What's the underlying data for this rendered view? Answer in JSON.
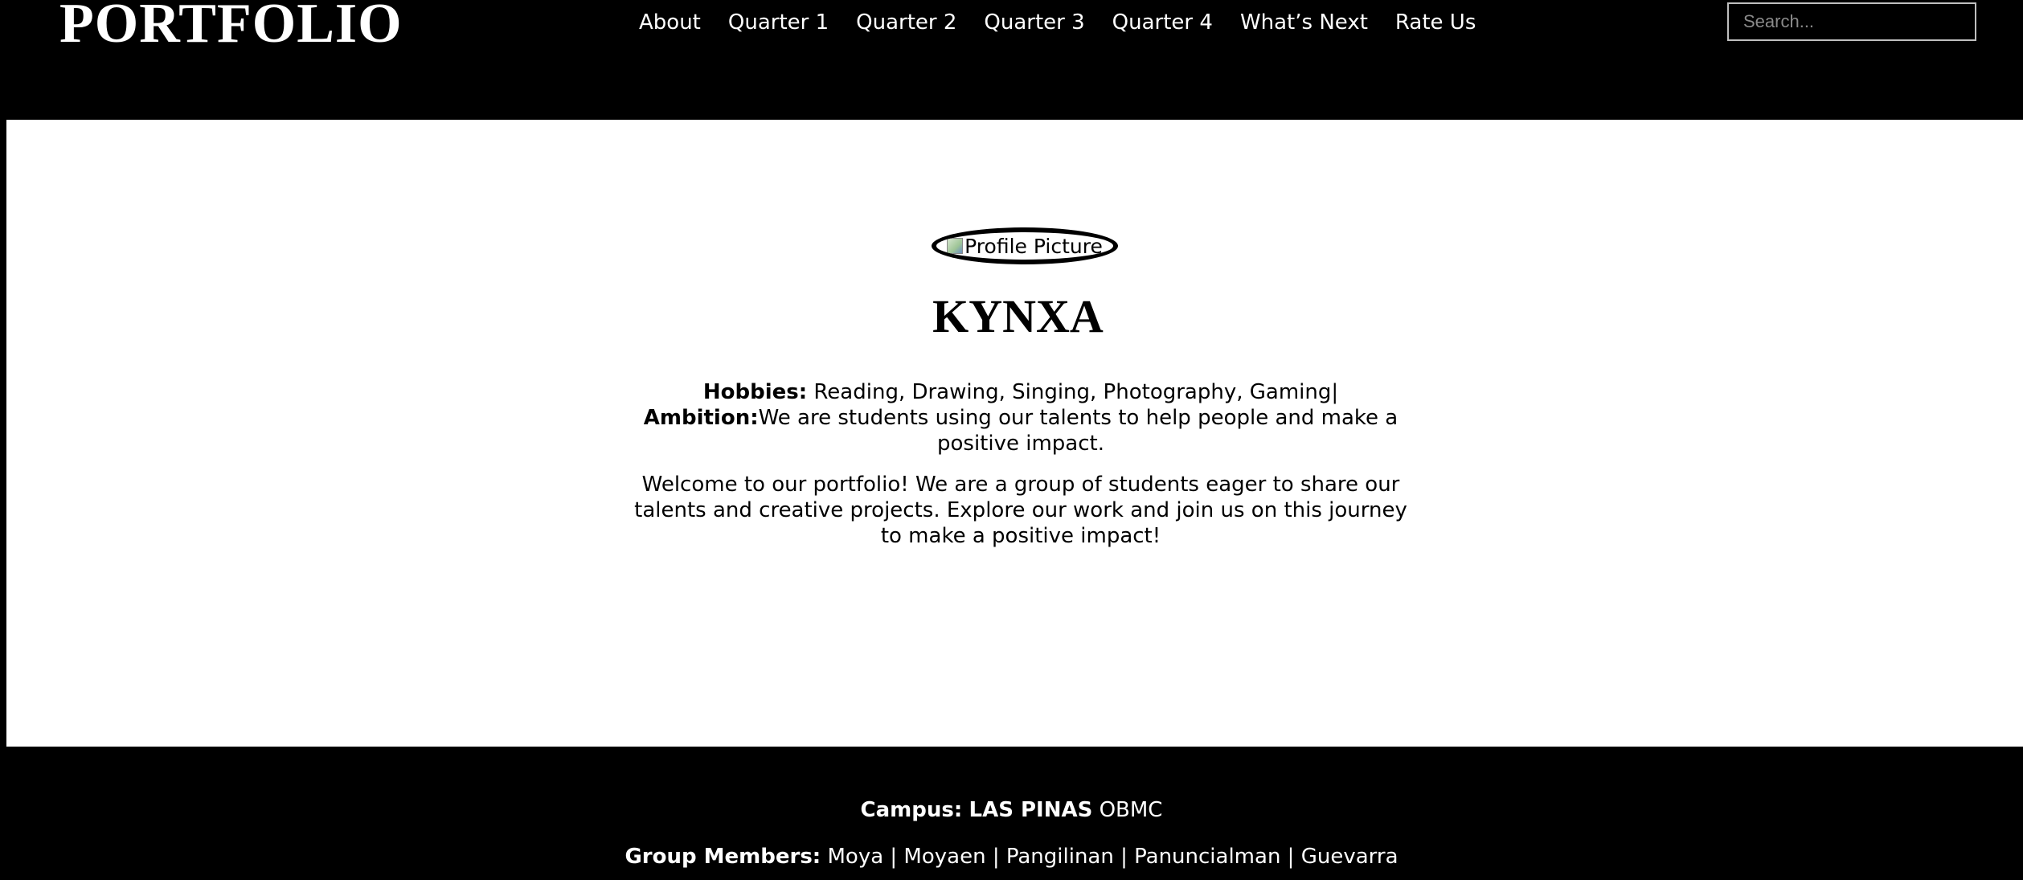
{
  "header": {
    "logo": "PORTFOLIO",
    "nav": [
      {
        "label": "About"
      },
      {
        "label": "Quarter 1"
      },
      {
        "label": "Quarter 2"
      },
      {
        "label": "Quarter 3"
      },
      {
        "label": "Quarter 4"
      },
      {
        "label": "What’s Next"
      },
      {
        "label": "Rate Us"
      }
    ],
    "search_placeholder": "Search..."
  },
  "profile": {
    "image_alt": "Profile Picture",
    "name": "KYNXA",
    "hobbies_label": "Hobbies:",
    "hobbies_value": " Reading, Drawing, Singing, Photography, Gaming|",
    "ambition_label": "Ambition:",
    "ambition_value": "We are students using our talents to help people and make a positive impact.",
    "welcome": "Welcome to our portfolio! We are a group of students eager to share our talents and creative projects. Explore our work and join us on this journey to make a positive impact!"
  },
  "footer": {
    "campus_label": "Campus:",
    "campus_value": "LAS PINAS",
    "campus_extra": " OBMC",
    "members_label": "Group Members:",
    "members_value": " Moya | Moyaen | Pangilinan | Panuncialman | Guevarra"
  },
  "colors": {
    "header_bg": "#000000",
    "main_bg": "#ffffff",
    "text_light": "#ffffff",
    "text_dark": "#000000"
  }
}
